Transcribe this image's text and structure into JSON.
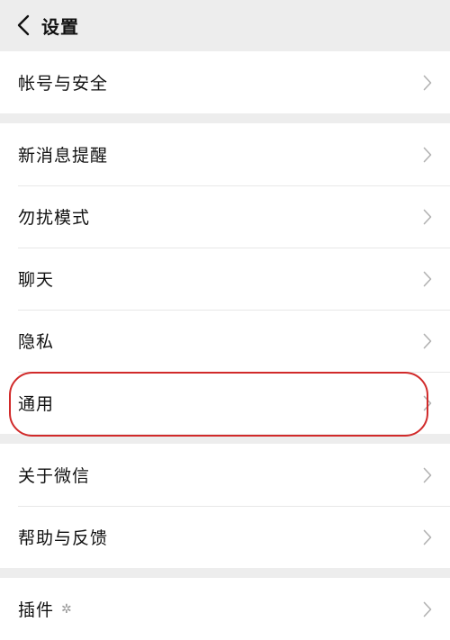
{
  "nav": {
    "title": "设置"
  },
  "groups": [
    {
      "items": [
        {
          "label": "帐号与安全"
        }
      ]
    },
    {
      "items": [
        {
          "label": "新消息提醒"
        },
        {
          "label": "勿扰模式"
        },
        {
          "label": "聊天"
        },
        {
          "label": "隐私"
        },
        {
          "label": "通用"
        }
      ]
    },
    {
      "items": [
        {
          "label": "关于微信"
        },
        {
          "label": "帮助与反馈"
        }
      ]
    },
    {
      "items": [
        {
          "label": "插件"
        }
      ]
    }
  ],
  "colors": {
    "background": "#ededed",
    "row_background": "#ffffff",
    "highlight": "#d12a2a",
    "chevron": "#b2b2b2"
  },
  "icons": {
    "back": "chevron-left-icon",
    "row_arrow": "chevron-right-icon",
    "plugin_badge": "sparkle-icon"
  }
}
